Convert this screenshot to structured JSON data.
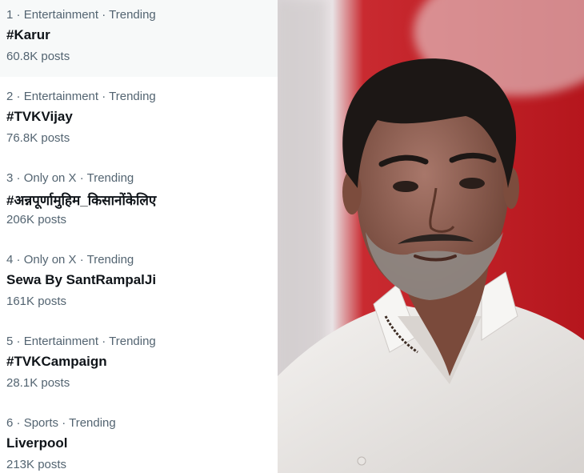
{
  "trends": [
    {
      "rank": "1",
      "category": "Entertainment · Trending",
      "name": "#Karur",
      "posts": "60.8K posts"
    },
    {
      "rank": "2",
      "category": "Entertainment · Trending",
      "name": "#TVKVijay",
      "posts": "76.8K posts"
    },
    {
      "rank": "3",
      "category": "Only on X · Trending",
      "name": "#अन्नपूर्णामुहिम_किसानोंकेलिए",
      "posts": "206K posts"
    },
    {
      "rank": "4",
      "category": "Only on X · Trending",
      "name": "Sewa By SantRampalJi",
      "posts": "161K posts"
    },
    {
      "rank": "5",
      "category": "Entertainment · Trending",
      "name": "#TVKCampaign",
      "posts": "28.1K posts"
    },
    {
      "rank": "6",
      "category": "Sports · Trending",
      "name": "Liverpool",
      "posts": "213K posts"
    }
  ],
  "separator": " · ",
  "colors": {
    "primary_text": "#0f1419",
    "secondary_text": "#536471",
    "hover_bg": "#f7f9f9",
    "photo_red": "#c8242b"
  },
  "photo": {
    "subject": "man-portrait-white-shirt"
  }
}
